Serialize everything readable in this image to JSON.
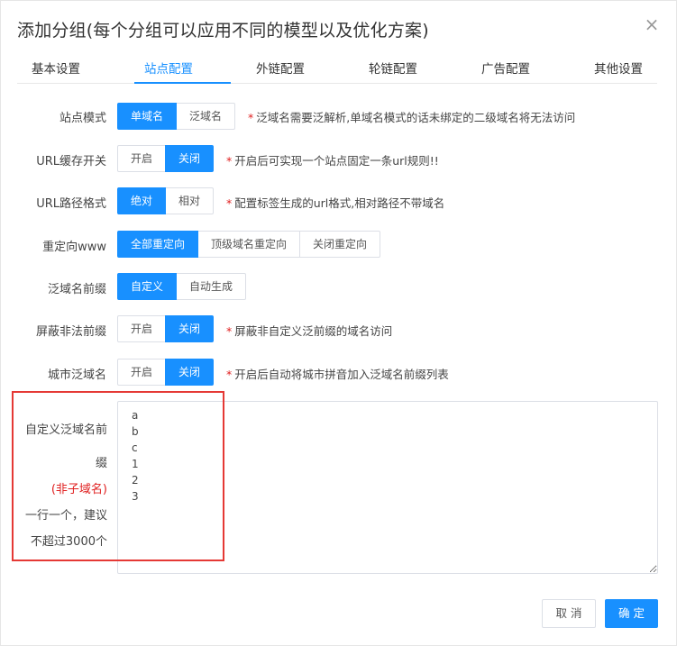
{
  "dialog": {
    "title": "添加分组(每个分组可以应用不同的模型以及优化方案)",
    "close_icon": "×"
  },
  "tabs": [
    {
      "label": "基本设置",
      "active": false
    },
    {
      "label": "站点配置",
      "active": true
    },
    {
      "label": "外链配置",
      "active": false
    },
    {
      "label": "轮链配置",
      "active": false
    },
    {
      "label": "广告配置",
      "active": false
    },
    {
      "label": "其他设置",
      "active": false
    }
  ],
  "rows": {
    "site_mode": {
      "label": "站点模式",
      "options": [
        "单域名",
        "泛域名"
      ],
      "selected": "单域名",
      "hint": "泛域名需要泛解析,单域名模式的话未绑定的二级域名将无法访问"
    },
    "url_cache": {
      "label": "URL缓存开关",
      "options": [
        "开启",
        "关闭"
      ],
      "selected": "关闭",
      "hint": "开启后可实现一个站点固定一条url规则!!"
    },
    "url_path": {
      "label": "URL路径格式",
      "options": [
        "绝对",
        "相对"
      ],
      "selected": "绝对",
      "hint": "配置标签生成的url格式,相对路径不带域名"
    },
    "redirect_www": {
      "label": "重定向www",
      "options": [
        "全部重定向",
        "顶级域名重定向",
        "关闭重定向"
      ],
      "selected": "全部重定向"
    },
    "wildcard_prefix": {
      "label": "泛域名前缀",
      "options": [
        "自定义",
        "自动生成"
      ],
      "selected": "自定义"
    },
    "block_illegal": {
      "label": "屏蔽非法前缀",
      "options": [
        "开启",
        "关闭"
      ],
      "selected": "关闭",
      "hint": "屏蔽非自定义泛前缀的域名访问"
    },
    "city_wildcard": {
      "label": "城市泛域名",
      "options": [
        "开启",
        "关闭"
      ],
      "selected": "关闭",
      "hint": "开启后自动将城市拼音加入泛域名前缀列表"
    }
  },
  "custom_prefix": {
    "label_line1": "自定义泛域名前",
    "label_line2": "缀",
    "label_red": "(非子域名)",
    "label_line3": "一行一个，建议",
    "label_line4": "不超过3000个",
    "value": "a\nb\nc\n1\n2\n3"
  },
  "footer": {
    "cancel_label": "取 消",
    "ok_label": "确 定"
  },
  "colors": {
    "primary": "#1890ff",
    "required_star": "#e02020",
    "highlight_box": "#e53935"
  },
  "icons": {
    "close": "close-icon"
  }
}
